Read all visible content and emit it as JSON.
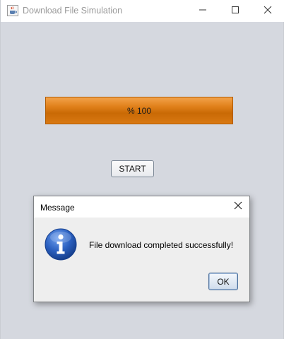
{
  "window": {
    "title": "Download File Simulation",
    "icons": {
      "app": "java-cup-icon",
      "minimize": "minimize-icon",
      "maximize": "maximize-icon",
      "close": "close-icon"
    }
  },
  "progress": {
    "label": "% 100",
    "percent": 100
  },
  "start_button": {
    "label": "START"
  },
  "dialog": {
    "title": "Message",
    "message": "File download completed successfully!",
    "ok_label": "OK",
    "icon": "info-icon"
  },
  "colors": {
    "progress_fill": "#e0801a",
    "progress_border": "#b05a00",
    "background": "#d5d8df",
    "info_icon": "#2a5fbf"
  }
}
